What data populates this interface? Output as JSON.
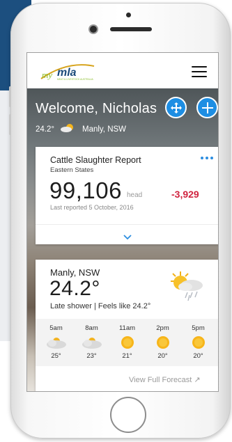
{
  "brand": {
    "logo_prefix": "my",
    "logo_word": "mla",
    "logo_tagline": "MEAT & LIVESTOCK AUSTRALIA"
  },
  "header": {
    "menu_icon": "hamburger-menu-icon"
  },
  "hero": {
    "welcome": "Welcome, Nicholas",
    "temperature": "24.2°",
    "location": "Manly, NSW",
    "weather_icon": "partly-cloudy-icon",
    "buttons": [
      {
        "icon": "move-arrows-icon"
      },
      {
        "icon": "plus-icon"
      }
    ]
  },
  "cattle_card": {
    "title": "Cattle Slaughter Report",
    "subtitle": "Eastern States",
    "value": "99,106",
    "unit": "head",
    "change": "-3,929",
    "date": "Last reported 5 October, 2016",
    "menu_icon": "more-dots-icon",
    "expand_icon": "chevron-down-icon"
  },
  "weather_card": {
    "location": "Manly, NSW",
    "temperature": "24.2°",
    "description": "Late shower | Feels like 24.2°",
    "icon": "sun-cloud-rain-icon",
    "forecast": [
      {
        "time": "5am",
        "temp": "25°",
        "icon": "cloud-icon"
      },
      {
        "time": "8am",
        "temp": "23°",
        "icon": "cloud-icon"
      },
      {
        "time": "11am",
        "temp": "21°",
        "icon": "sun-icon"
      },
      {
        "time": "2pm",
        "temp": "20°",
        "icon": "sun-icon"
      },
      {
        "time": "5pm",
        "temp": "20°",
        "icon": "sun-icon"
      }
    ],
    "view_full": "View Full Forecast ↗"
  },
  "colors": {
    "accent_blue": "#1e8ee3",
    "negative_red": "#d0233f",
    "brand_navy": "#1c4f7f",
    "logo_green": "#8cbf2f"
  }
}
